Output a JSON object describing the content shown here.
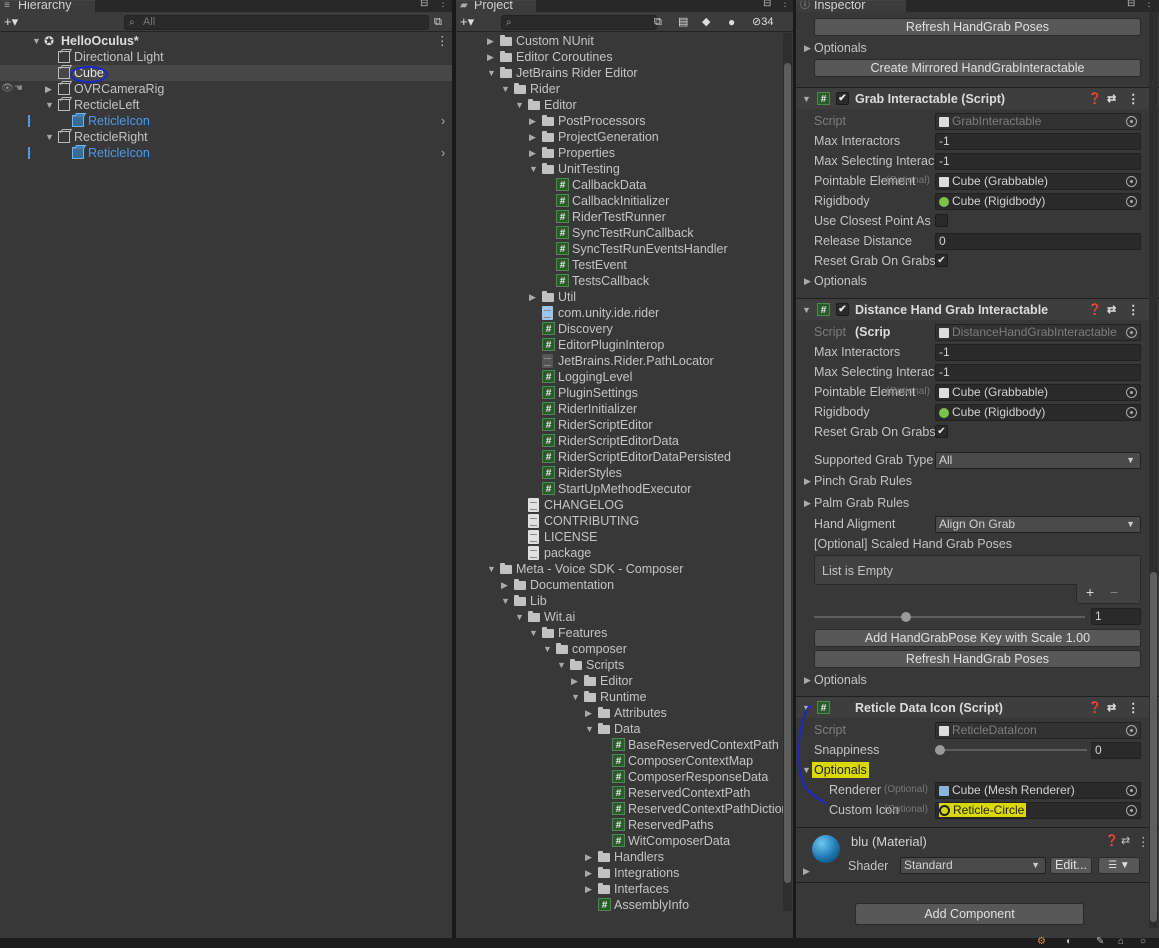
{
  "hierarchy": {
    "tab": "Hierarchy",
    "search_placeholder": "All",
    "scene": "HelloOculus*",
    "items": [
      {
        "label": "Directional Light"
      },
      {
        "label": "Cube"
      },
      {
        "label": "OVRCameraRig"
      },
      {
        "label": "RecticleLeft"
      },
      {
        "label": "ReticleIcon"
      },
      {
        "label": "RecticleRight"
      },
      {
        "label": "ReticleIcon"
      }
    ]
  },
  "project": {
    "tab": "Project",
    "hidden_count": "34",
    "items": [
      "Custom NUnit",
      "Editor Coroutines",
      "JetBrains Rider Editor",
      "Rider",
      "Editor",
      "PostProcessors",
      "ProjectGeneration",
      "Properties",
      "UnitTesting",
      "CallbackData",
      "CallbackInitializer",
      "RiderTestRunner",
      "SyncTestRunCallback",
      "SyncTestRunEventsHandler",
      "TestEvent",
      "TestsCallback",
      "Util",
      "com.unity.ide.rider",
      "Discovery",
      "EditorPluginInterop",
      "JetBrains.Rider.PathLocator",
      "LoggingLevel",
      "PluginSettings",
      "RiderInitializer",
      "RiderScriptEditor",
      "RiderScriptEditorData",
      "RiderScriptEditorDataPersisted",
      "RiderStyles",
      "StartUpMethodExecutor",
      "CHANGELOG",
      "CONTRIBUTING",
      "LICENSE",
      "package",
      "Meta - Voice SDK - Composer",
      "Documentation",
      "Lib",
      "Wit.ai",
      "Features",
      "composer",
      "Scripts",
      "Editor",
      "Runtime",
      "Attributes",
      "Data",
      "BaseReservedContextPath",
      "ComposerContextMap",
      "ComposerResponseData",
      "ReservedContextPath",
      "ReservedContextPathDiction",
      "ReservedPaths",
      "WitComposerData",
      "Handlers",
      "Integrations",
      "Interfaces",
      "AssemblyInfo"
    ]
  },
  "inspector": {
    "tab": "Inspector",
    "refresh_btn": "Refresh HandGrab Poses",
    "optionals": "Optionals",
    "mirror_btn": "Create Mirrored HandGrabInteractable",
    "grab": {
      "title": "Grab Interactable (Script)",
      "script_label": "Script",
      "script_val": "GrabInteractable",
      "max_inter_label": "Max Interactors",
      "max_inter_val": "-1",
      "max_sel_label": "Max Selecting Interac",
      "max_sel_val": "-1",
      "pointable_label": "Pointable Element",
      "optional": "(Optional)",
      "pointable_val": "Cube (Grabbable)",
      "rigidbody_label": "Rigidbody",
      "rigidbody_val": "Cube (Rigidbody)",
      "closest_label": "Use Closest Point As",
      "release_label": "Release Distance",
      "release_val": "0",
      "reset_label": "Reset Grab On Grabs",
      "optionals": "Optionals"
    },
    "dist": {
      "title": "Distance Hand Grab Interactable (Scrip",
      "script_label": "Script",
      "script_val": "DistanceHandGrabInteractable",
      "max_inter_label": "Max Interactors",
      "max_inter_val": "-1",
      "max_sel_label": "Max Selecting Interac",
      "max_sel_val": "-1",
      "pointable_label": "Pointable Element",
      "optional": "(Optional)",
      "pointable_val": "Cube (Grabbable)",
      "rigidbody_label": "Rigidbody",
      "rigidbody_val": "Cube (Rigidbody)",
      "reset_label": "Reset Grab On Grabs",
      "supported_label": "Supported Grab Type",
      "supported_val": "All",
      "pinch_label": "Pinch Grab Rules",
      "palm_label": "Palm Grab Rules",
      "align_label": "Hand Aligment",
      "align_val": "Align On Grab",
      "scaled_label": "[Optional] Scaled Hand Grab Poses",
      "list_empty": "List is Empty",
      "plus": "+",
      "minus": "−",
      "scale_val": "1",
      "add_key_btn": "Add HandGrabPose Key with Scale 1.00",
      "refresh_btn": "Refresh HandGrab Poses",
      "optionals": "Optionals"
    },
    "reticle": {
      "title": "Reticle Data Icon (Script)",
      "script_label": "Script",
      "script_val": "ReticleDataIcon",
      "snap_label": "Snappiness",
      "snap_val": "0",
      "optionals": "Optionals",
      "renderer_label": "Renderer",
      "optional": "(Optional)",
      "renderer_val": "Cube (Mesh Renderer)",
      "custom_label": "Custom Icon",
      "custom_val": "Reticle-Circle"
    },
    "material": {
      "name": "blu (Material)",
      "shader_label": "Shader",
      "shader_val": "Standard",
      "edit_btn": "Edit..."
    },
    "add_component": "Add Component"
  }
}
